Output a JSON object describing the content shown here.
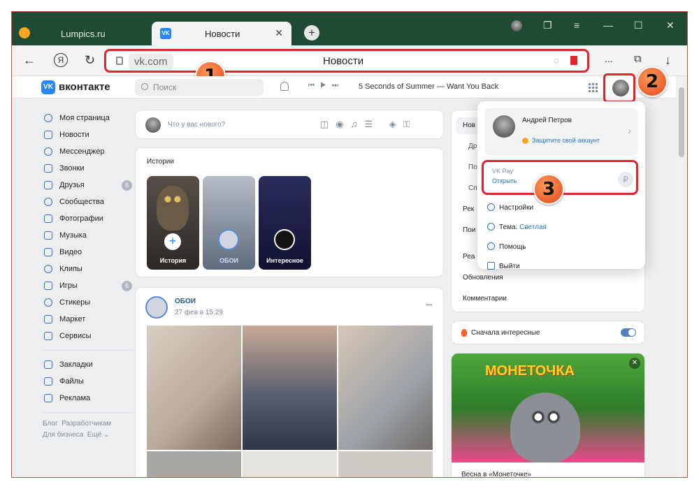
{
  "browser": {
    "tab1_label": "Lumpics.ru",
    "tab2_label": "Новости",
    "tab2_close": "✕",
    "new_tab": "+",
    "url_host": "vk.com",
    "page_title": "Новости",
    "more": "...",
    "back": "←",
    "yandex": "Я",
    "reload": "↻",
    "download": "↓",
    "win_min": "—",
    "win_max": "☐",
    "win_close": "✕"
  },
  "annotations": [
    "1",
    "2",
    "3"
  ],
  "vk": {
    "logo_letters": "VK",
    "brand": "вконтакте",
    "search_placeholder": "Поиск",
    "now_playing": "5 Seconds of Summer — Want You Back",
    "nav": [
      {
        "label": "Моя страница"
      },
      {
        "label": "Новости"
      },
      {
        "label": "Мессенджер"
      },
      {
        "label": "Звонки"
      },
      {
        "label": "Друзья",
        "count": "6"
      },
      {
        "label": "Сообщества"
      },
      {
        "label": "Фотографии"
      },
      {
        "label": "Музыка"
      },
      {
        "label": "Видео"
      },
      {
        "label": "Клипы"
      },
      {
        "label": "Игры",
        "count": "6"
      },
      {
        "label": "Стикеры"
      },
      {
        "label": "Маркет"
      },
      {
        "label": "Сервисы"
      }
    ],
    "nav2": [
      {
        "label": "Закладки"
      },
      {
        "label": "Файлы"
      },
      {
        "label": "Реклама"
      }
    ],
    "footer": {
      "blog": "Блог",
      "dev": "Разработчикам",
      "biz": "Для бизнеса",
      "more": "Ещё ⌄"
    },
    "composer_placeholder": "Что у вас нового?",
    "stories": {
      "title": "Истории",
      "items": [
        {
          "label": "История",
          "color": "#3d3a36"
        },
        {
          "label": "ОБОИ",
          "color": "#7d8ea3"
        },
        {
          "label": "Интересное",
          "color": "#1c2350"
        }
      ]
    },
    "post": {
      "author": "ОБОИ",
      "date": "27 фев в 15:29",
      "more": "•••"
    },
    "right": {
      "items": [
        "Нов",
        "Др",
        "По",
        "Сп",
        "Рек",
        "Пои",
        "Реа",
        "Обновления",
        "Комментарии"
      ],
      "interesting": "Сначала интересные",
      "ad_logo": "МОНЕТОЧКА",
      "ad_caption": "Весна в «Монеточке»"
    },
    "popup": {
      "name": "Андрей Петров",
      "protect": "Защитите свой аккаунт",
      "vkpay": "VK Pay",
      "open": "Открыть",
      "settings": "Настройки",
      "theme_label": "Тема:",
      "theme_value": "Светлая",
      "help": "Помощь",
      "logout": "Выйти"
    }
  },
  "colors": {
    "accent": "#2787f5",
    "highlight": "#e0262a",
    "tabbar": "#1f4a33"
  }
}
